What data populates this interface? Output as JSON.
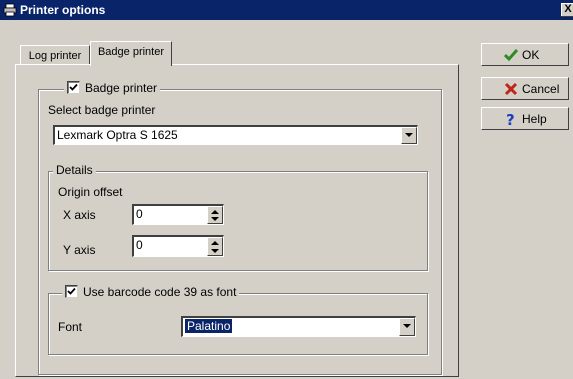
{
  "window": {
    "title": "Printer options",
    "close_label": "X",
    "icon": "printer-icon"
  },
  "tabs": [
    {
      "label": "Log printer",
      "active": false
    },
    {
      "label": "Badge printer",
      "active": true
    }
  ],
  "badge_printer": {
    "enable_checkbox": {
      "label": "Badge printer",
      "checked": true
    },
    "select_label": "Select badge printer",
    "selected_printer": "Lexmark Optra S 1625"
  },
  "details": {
    "legend": "Details",
    "origin_offset_label": "Origin offset",
    "x_axis": {
      "label": "X axis",
      "value": "0"
    },
    "y_axis": {
      "label": "Y axis",
      "value": "0"
    }
  },
  "barcode": {
    "checkbox": {
      "label": "Use barcode code 39 as font",
      "checked": true
    },
    "font_label": "Font",
    "font_value": "Palatino"
  },
  "buttons": {
    "ok": {
      "label": "OK",
      "icon": "checkmark-icon",
      "color": "#2e8b22"
    },
    "cancel": {
      "label": "Cancel",
      "icon": "x-mark-icon",
      "color": "#c0251a"
    },
    "help": {
      "label": "Help",
      "icon": "question-mark-icon",
      "color": "#1a3fc0"
    }
  },
  "colors": {
    "titlebar": "#0a246a",
    "face": "#d4d0c8",
    "selection": "#0a246a"
  }
}
